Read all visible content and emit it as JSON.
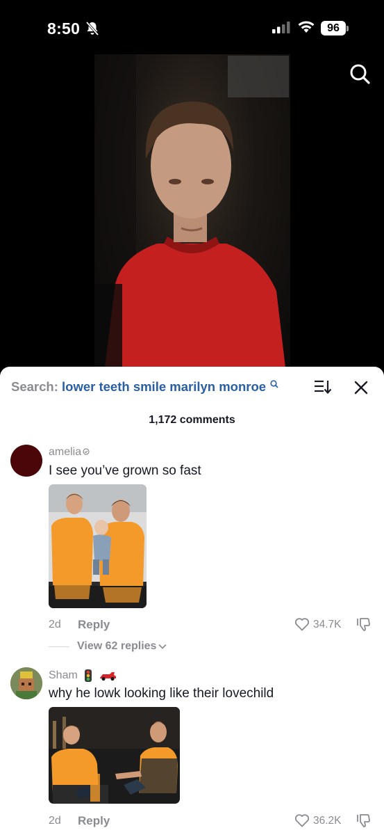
{
  "status_bar": {
    "time": "8:50",
    "battery": "96"
  },
  "sheet": {
    "search_prefix": "Search:",
    "search_query": "lower teeth smile marilyn monroe",
    "comment_count": "1,172 comments"
  },
  "comments": [
    {
      "username": "amelia",
      "text": "I see you’ve grown so fast",
      "date": "2d",
      "reply_label": "Reply",
      "likes": "34.7K",
      "view_replies": "View 62 replies",
      "avatar_color": "#4a0608"
    },
    {
      "username": "Sham",
      "text": "why he lowk looking like their lovechild",
      "date": "2d",
      "reply_label": "Reply",
      "likes": "36.2K"
    }
  ],
  "colors": {
    "accent_query": "#2a5fa3",
    "muted": "#8a8b91",
    "text": "#161823",
    "papaya": "#f39a2b"
  },
  "icons": [
    "bell-slash-icon",
    "signal-icon",
    "wifi-icon",
    "search-icon",
    "sort-icon",
    "close-icon",
    "heart-icon",
    "dislike-icon",
    "chevron-down-icon",
    "traffic-light-icon",
    "race-car-icon"
  ]
}
